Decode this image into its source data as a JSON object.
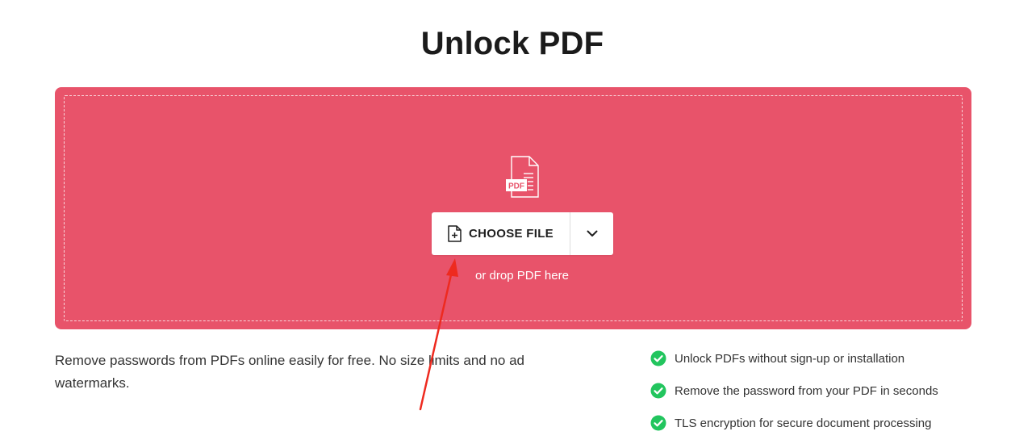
{
  "page": {
    "title": "Unlock PDF"
  },
  "upload": {
    "file_icon_label": "PDF",
    "choose_file_label": "CHOOSE FILE",
    "drop_hint": "or drop PDF here",
    "accent_color": "#e8536a"
  },
  "description": "Remove passwords from PDFs online easily for free. No size limits and no ad watermarks.",
  "features": [
    {
      "label": "Unlock PDFs without sign-up or installation",
      "icon": "check-circle-icon"
    },
    {
      "label": "Remove the password from your PDF in seconds",
      "icon": "check-circle-icon"
    },
    {
      "label": "TLS encryption for secure document processing",
      "icon": "check-circle-icon"
    }
  ],
  "colors": {
    "check": "#22c55e",
    "annotation_arrow": "#ee2a1f"
  }
}
